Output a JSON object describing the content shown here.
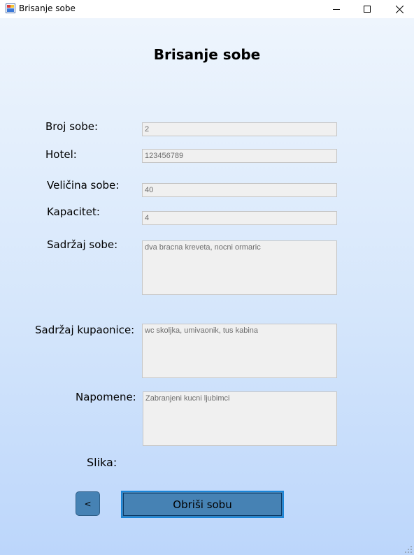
{
  "window": {
    "title": "Brisanje sobe"
  },
  "form": {
    "heading": "Brisanje sobe",
    "fields": {
      "broj_sobe": {
        "label": "Broj sobe:",
        "value": "2"
      },
      "hotel": {
        "label": "Hotel:",
        "value": "123456789"
      },
      "velicina_sobe": {
        "label": "Veličina sobe:",
        "value": "40"
      },
      "kapacitet": {
        "label": "Kapacitet:",
        "value": "4"
      },
      "sadrzaj_sobe": {
        "label": "Sadržaj sobe:",
        "value": "dva bracna kreveta, nocni ormaric"
      },
      "sadrzaj_kupaonice": {
        "label": "Sadržaj kupaonice:",
        "value": "wc skoljka, umivaonik, tus kabina"
      },
      "napomene": {
        "label": "Napomene:",
        "value": "Zabranjeni kucni ljubimci"
      }
    },
    "slika_label": "Slika:"
  },
  "buttons": {
    "back_label": "<",
    "delete_label": "Obriši sobu"
  },
  "colors": {
    "button_fill": "#4682b4",
    "field_fill": "#f0f0f0",
    "gradient_top": "#eef5fd",
    "gradient_bottom": "#bcd6fb"
  }
}
